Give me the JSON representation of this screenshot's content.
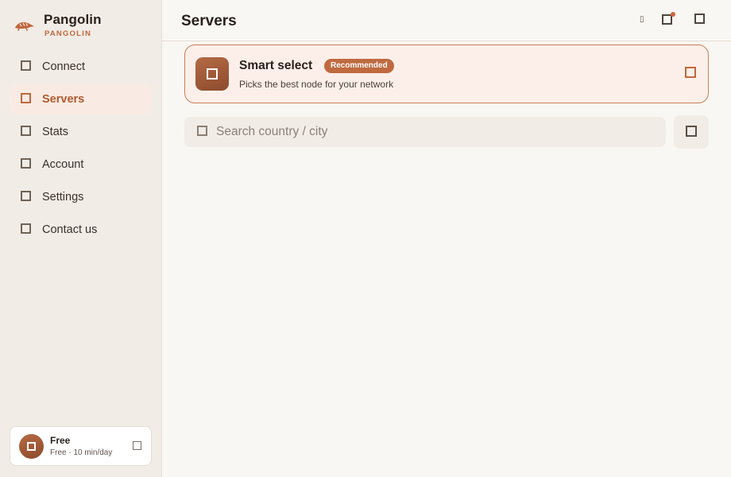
{
  "brand": {
    "name": "Pangolin",
    "subtitle": "PANGOLIN",
    "logo_icon": "pangolin-logo-icon",
    "accent_color": "#c0673c"
  },
  "nav": {
    "items": [
      {
        "label": "Connect",
        "icon": "connect-icon",
        "active": false
      },
      {
        "label": "Servers",
        "icon": "servers-icon",
        "active": true
      },
      {
        "label": "Stats",
        "icon": "stats-icon",
        "active": false
      },
      {
        "label": "Account",
        "icon": "account-icon",
        "active": false
      },
      {
        "label": "Settings",
        "icon": "settings-icon",
        "active": false
      },
      {
        "label": "Contact us",
        "icon": "contact-icon",
        "active": false
      }
    ]
  },
  "plan": {
    "name": "Free",
    "detail": "Free · 10 min/day",
    "avatar_icon": "avatar-icon",
    "action_icon": "chevron-icon"
  },
  "header": {
    "title": "Servers",
    "icons": [
      "status-icon",
      "notification-icon",
      "user-icon"
    ],
    "notification_dot_color": "#d4633b"
  },
  "smart_select": {
    "title": "Smart select",
    "badge": "Recommended",
    "description": "Picks the best node for your network",
    "icon": "smart-select-icon",
    "selected_icon": "checkbox-icon"
  },
  "search": {
    "placeholder": "Search country / city",
    "value": "",
    "icon": "search-icon",
    "filter_icon": "filter-icon"
  }
}
